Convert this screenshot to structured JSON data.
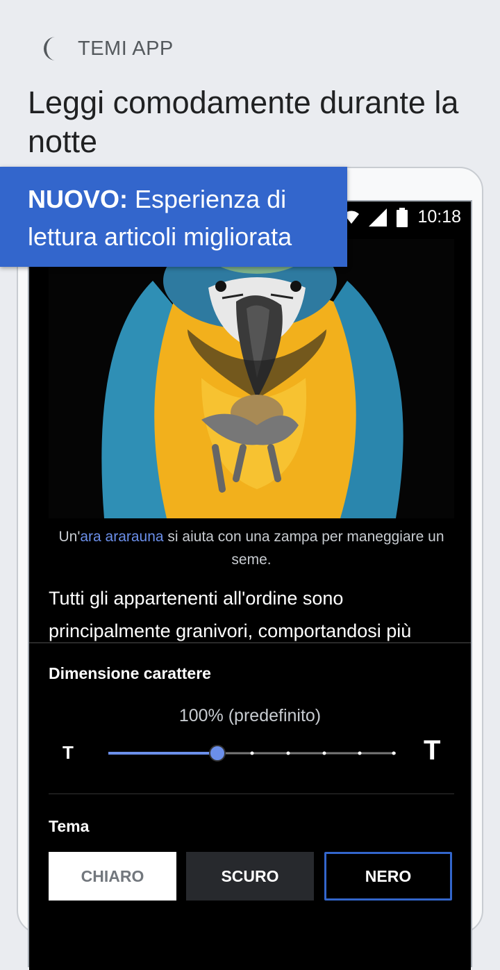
{
  "header": {
    "section_label": "TEMI APP",
    "icon": "moon-icon"
  },
  "headline": "Leggi comodamente durante la notte",
  "banner": {
    "prefix": "NUOVO:",
    "text": " Esperienza di lettura articoli migliorata"
  },
  "status_bar": {
    "time": "10:18"
  },
  "article": {
    "caption_prefix": "Un'",
    "caption_link": "ara ararauna",
    "caption_suffix": " si aiuta con una zampa per maneggiare un seme.",
    "body": "Tutti gli appartenenti all'ordine sono principalmente granivori, comportandosi più"
  },
  "settings": {
    "font_size_title": "Dimensione carattere",
    "font_size_value": "100% (predefinito)",
    "font_size_fraction": 0.38,
    "small_t": "T",
    "large_t": "T",
    "theme_title": "Tema",
    "themes": [
      "CHIARO",
      "SCURO",
      "NERO"
    ],
    "selected_theme": "NERO"
  },
  "colors": {
    "accent": "#3366cc",
    "background": "#eaecf0",
    "screen": "#000000"
  }
}
